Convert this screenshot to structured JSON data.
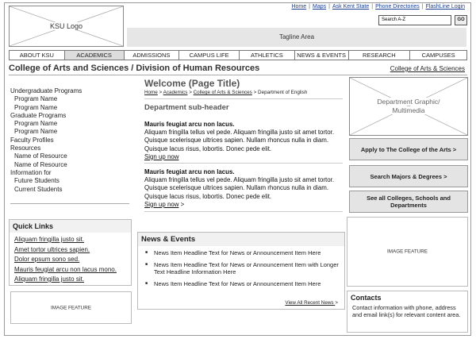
{
  "header": {
    "logo_label": "KSU Logo",
    "tagline": "Tagline Area",
    "utility_links": [
      "Home",
      "Maps",
      "Ask Kent State",
      "Phone Directories",
      "FlashLine Login"
    ],
    "search_value": "Search A-Z",
    "go_label": "GO"
  },
  "nav": {
    "items": [
      "ABOUT KSU",
      "ACADEMICS",
      "ADMISSIONS",
      "CAMPUS LIFE",
      "ATHLETICS",
      "NEWS & EVENTS",
      "RESEARCH",
      "CAMPUSES"
    ],
    "active": "ACADEMICS"
  },
  "college": {
    "title": "College of Arts and Sciences / Division of Human Resources",
    "link": "College of Arts & Sciences"
  },
  "sidebar": {
    "items": [
      {
        "label": "Undergraduate Programs",
        "level": 0
      },
      {
        "label": "Program Name",
        "level": 1
      },
      {
        "label": "Program Name",
        "level": 1
      },
      {
        "label": "Graduate Programs",
        "level": 0
      },
      {
        "label": "Program Name",
        "level": 1
      },
      {
        "label": "Program Name",
        "level": 1
      },
      {
        "label": "Faculty Profiles",
        "level": 0
      },
      {
        "label": "Resources",
        "level": 0
      },
      {
        "label": "Name of Resource",
        "level": 1
      },
      {
        "label": "Name of Resource",
        "level": 1
      },
      {
        "label": "Information for",
        "level": 0
      },
      {
        "label": "Future Students",
        "level": 1
      },
      {
        "label": "Current Students",
        "level": 1
      }
    ]
  },
  "quick_links": {
    "title": "Quick Links",
    "items": [
      "Aliquam fringilla justo sit.",
      "Amet tortor ultrices sapien.",
      "Dolor epsum sono sed.",
      "Mauris feugiat arcu non lacus mono.",
      "Aliquam fringilla justo sit."
    ]
  },
  "left_feature": "IMAGE FEATURE",
  "main": {
    "page_title": "Welcome (Page Title)",
    "breadcrumb": [
      "Home",
      "Academics",
      "College of Arts & Sciences",
      "Department of English"
    ],
    "breadcrumb_sep": ">",
    "subheader": "Department sub-header",
    "articles": [
      {
        "heading": "Mauris feugiat arcu non lacus.",
        "body": "Aliquam fringilla tellus vel pede. Aliquam fringilla justo sit amet tortor. Quisque scelerisque ultrices sapien. Nullam rhoncus nulla in diam. Quisque lacus risus, lobortis. Donec pede elit.",
        "more": "Sign up now",
        "more_arrow": ""
      },
      {
        "heading": "Mauris feugiat arcu non lacus.",
        "body": "Aliquam fringilla tellus vel pede. Aliquam fringilla justo sit amet tortor. Quisque scelerisque ultrices sapien. Nullam rhoncus nulla in diam. Quisque lacus risus, lobortis. Donec pede elit.",
        "more": "Sign up now",
        "more_arrow": ">"
      }
    ]
  },
  "news": {
    "title": "News & Events",
    "items": [
      "News Item Headline Text for News or Announcement Item Here",
      "News Item Headline Text for News or Announcement Item with Longer Text Headline Information Here",
      "News Item Headline Text for News or Announcement Item Here"
    ],
    "view_all": "View All Recent News",
    "view_all_arrow": ">"
  },
  "right": {
    "graphic_label": "Department Graphic/ Multimedia",
    "buttons": [
      "Apply to The College of the Arts >",
      "Search Majors & Degrees >",
      "See all Colleges, Schools and Departments"
    ],
    "feature": "IMAGE FEATURE",
    "contacts_title": "Contacts",
    "contacts_text": "Contact information with phone, address and email link(s) for relevant content area."
  }
}
